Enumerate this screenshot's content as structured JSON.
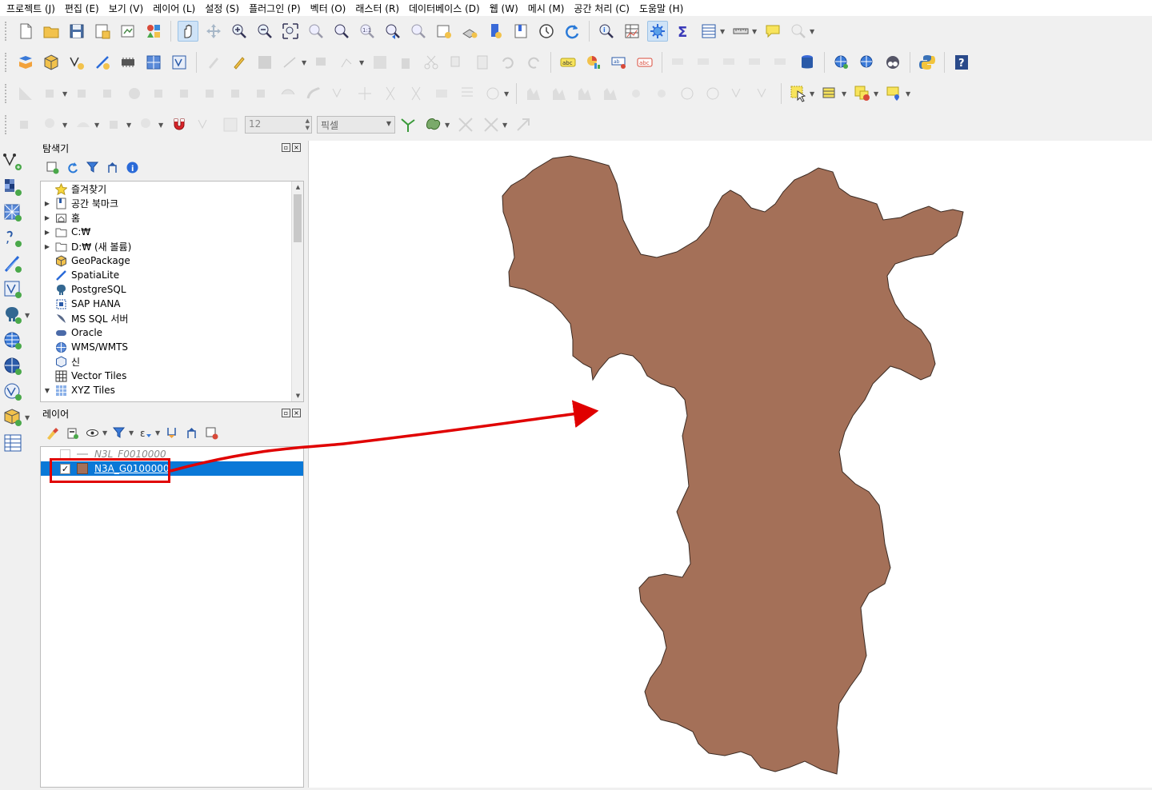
{
  "menu": [
    "프로젝트 (J)",
    "편집 (E)",
    "보기 (V)",
    "레이어 (L)",
    "설정 (S)",
    "플러그인 (P)",
    "벡터 (O)",
    "래스터 (R)",
    "데이터베이스 (D)",
    "웹 (W)",
    "메시 (M)",
    "공간 처리 (C)",
    "도움말 (H)"
  ],
  "snapping": {
    "tolerance": "12",
    "units": "픽셀"
  },
  "browser": {
    "title": "탐색기",
    "items": [
      {
        "label": "즐겨찾기",
        "icon": "star-icon",
        "expand": ""
      },
      {
        "label": "공간 북마크",
        "icon": "bookmark-icon",
        "expand": "▶"
      },
      {
        "label": "홈",
        "icon": "home-folder-icon",
        "expand": "▶"
      },
      {
        "label": "C:₩",
        "icon": "folder-icon",
        "expand": "▶"
      },
      {
        "label": "D:₩ (새 볼륨)",
        "icon": "folder-icon",
        "expand": "▶"
      },
      {
        "label": "GeoPackage",
        "icon": "geopackage-icon",
        "expand": ""
      },
      {
        "label": "SpatiaLite",
        "icon": "spatialite-icon",
        "expand": ""
      },
      {
        "label": "PostgreSQL",
        "icon": "postgresql-icon",
        "expand": ""
      },
      {
        "label": "SAP HANA",
        "icon": "sap-hana-icon",
        "expand": ""
      },
      {
        "label": "MS SQL 서버",
        "icon": "mssql-icon",
        "expand": ""
      },
      {
        "label": "Oracle",
        "icon": "oracle-icon",
        "expand": ""
      },
      {
        "label": "WMS/WMTS",
        "icon": "globe-icon",
        "expand": ""
      },
      {
        "label": "신",
        "icon": "package-icon",
        "expand": ""
      },
      {
        "label": "Vector Tiles",
        "icon": "vector-tiles-icon",
        "expand": ""
      },
      {
        "label": "XYZ Tiles",
        "icon": "xyz-tiles-icon",
        "expand": "▼"
      }
    ]
  },
  "layers": {
    "title": "레이어",
    "items": [
      {
        "name": "N3L_F0010000",
        "checked": false,
        "selected": false
      },
      {
        "name": "N3A_G0100000",
        "checked": true,
        "selected": true,
        "color": "#a47058"
      }
    ]
  },
  "colors": {
    "accent": "#0a78d7",
    "polygon_fill": "#a47058",
    "annotation": "#e00000"
  }
}
